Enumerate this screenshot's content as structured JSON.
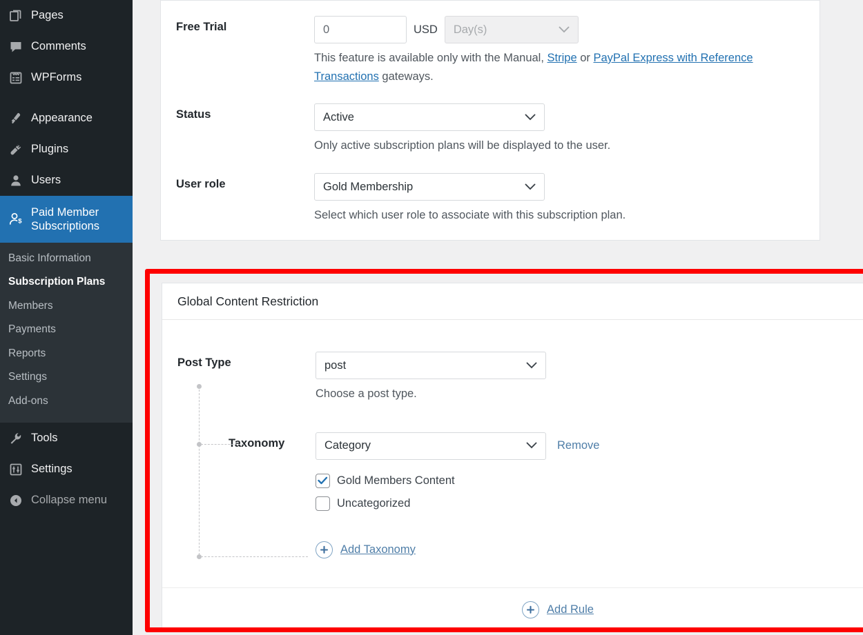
{
  "sidebar": {
    "items": [
      {
        "label": "Pages",
        "icon": "pages-icon",
        "active": false
      },
      {
        "label": "Comments",
        "icon": "comments-icon",
        "active": false
      },
      {
        "label": "WPForms",
        "icon": "wpforms-icon",
        "active": false
      },
      {
        "label": "Appearance",
        "icon": "appearance-icon",
        "active": false
      },
      {
        "label": "Plugins",
        "icon": "plugins-icon",
        "active": false
      },
      {
        "label": "Users",
        "icon": "users-icon",
        "active": false
      },
      {
        "label": "Paid Member Subscriptions",
        "icon": "paid-member-subscriptions-icon",
        "active": true
      },
      {
        "label": "Tools",
        "icon": "tools-icon",
        "active": false
      },
      {
        "label": "Settings",
        "icon": "settings-icon",
        "active": false
      },
      {
        "label": "Collapse menu",
        "icon": "collapse-icon",
        "active": false
      }
    ],
    "submenu": [
      {
        "label": "Basic Information",
        "current": false
      },
      {
        "label": "Subscription Plans",
        "current": true
      },
      {
        "label": "Members",
        "current": false
      },
      {
        "label": "Payments",
        "current": false
      },
      {
        "label": "Reports",
        "current": false
      },
      {
        "label": "Settings",
        "current": false
      },
      {
        "label": "Add-ons",
        "current": false
      }
    ],
    "active_label_line1": "Paid Member",
    "active_label_line2": "Subscriptions",
    "colors": {
      "bg": "#1d2327",
      "submenu_bg": "#2c3338",
      "active": "#2271b1"
    }
  },
  "form": {
    "free_trial": {
      "label": "Free Trial",
      "amount_value": "0",
      "currency": "USD",
      "period_placeholder": "Day(s)",
      "period_disabled": true,
      "hint_before": "This feature is available only with the Manual, ",
      "hint_link1": "Stripe",
      "hint_mid": " or ",
      "hint_link2": "PayPal Express with Reference Transactions",
      "hint_after": " gateways."
    },
    "status": {
      "label": "Status",
      "value": "Active",
      "hint": "Only active subscription plans will be displayed to the user."
    },
    "user_role": {
      "label": "User role",
      "value": "Gold Membership",
      "hint": "Select which user role to associate with this subscription plan."
    }
  },
  "restriction_panel": {
    "title": "Global Content Restriction",
    "actions": [
      {
        "name": "move-up-icon",
        "glyph": "chevron-up"
      },
      {
        "name": "move-down-icon",
        "glyph": "chevron-down"
      },
      {
        "name": "toggle-panel-icon",
        "glyph": "triangle-up"
      }
    ],
    "rule": {
      "post_type": {
        "label": "Post Type",
        "value": "post",
        "hint": "Choose a post type."
      },
      "taxonomy": {
        "label": "Taxonomy",
        "value": "Category",
        "remove_label": "Remove",
        "terms": [
          {
            "label": "Gold Members Content",
            "checked": true
          },
          {
            "label": "Uncategorized",
            "checked": false
          }
        ]
      },
      "add_taxonomy_label": "Add Taxonomy",
      "remove_rule_icon": "close-icon"
    },
    "add_rule_label": "Add Rule"
  },
  "highlight": {
    "color": "#fe0000"
  }
}
